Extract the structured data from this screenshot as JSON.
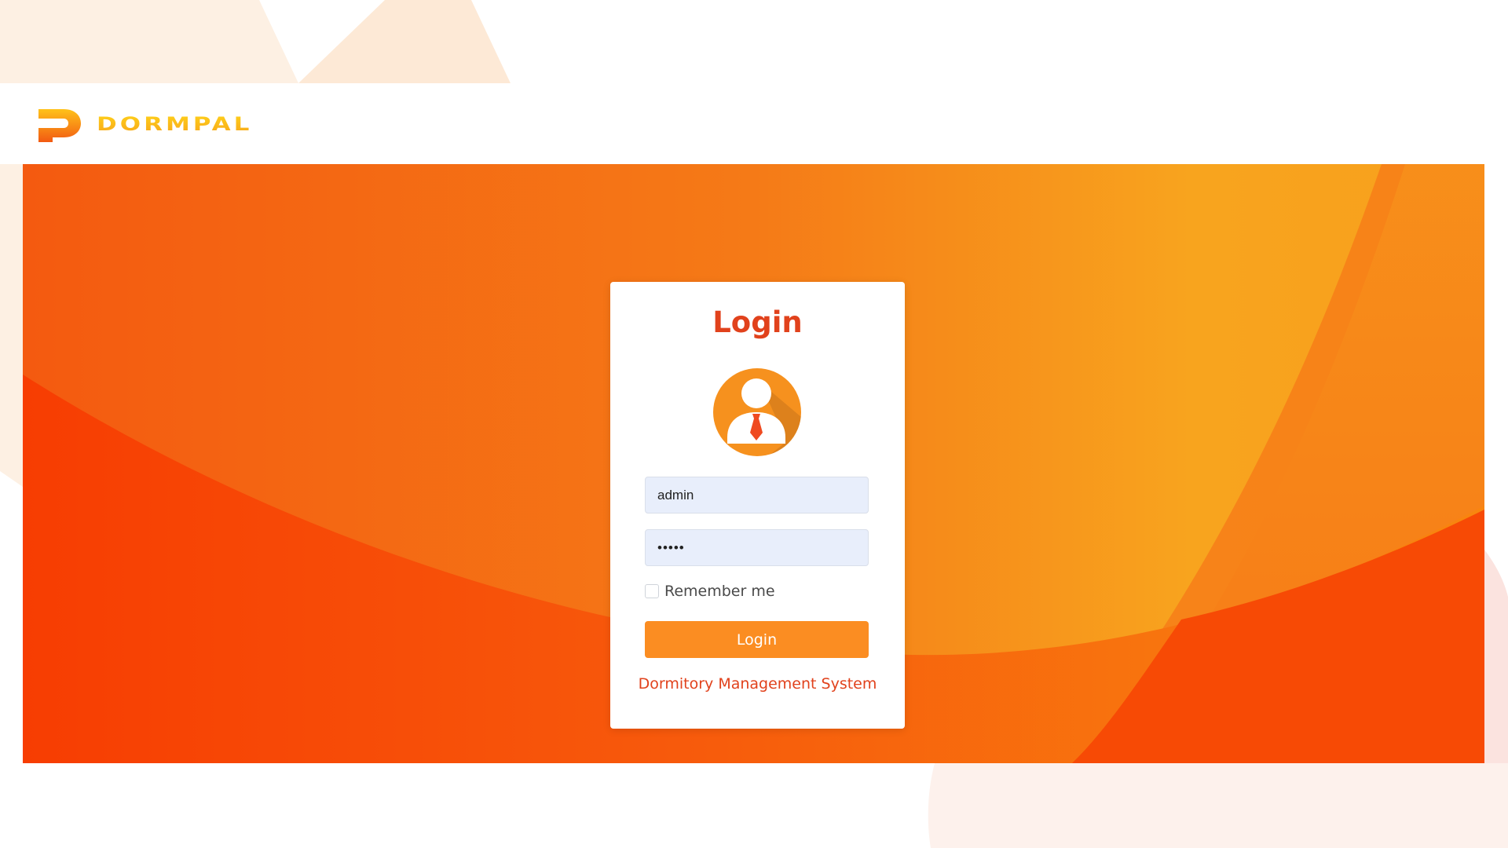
{
  "header": {
    "brand_name": "DORMPAL",
    "logo_icon": "dormpal-logo-icon"
  },
  "login_card": {
    "title": "Login",
    "avatar_icon": "user-avatar-icon",
    "username": {
      "value": "admin",
      "placeholder": ""
    },
    "password": {
      "value": "admin",
      "placeholder": ""
    },
    "remember_label": "Remember me",
    "remember_checked": false,
    "submit_label": "Login",
    "footer_link": "Dormitory Management System"
  },
  "colors": {
    "accent_red": "#e1421c",
    "accent_orange": "#fb8d22",
    "brand_yellow": "#f5b800",
    "input_background": "#e8eefb"
  }
}
